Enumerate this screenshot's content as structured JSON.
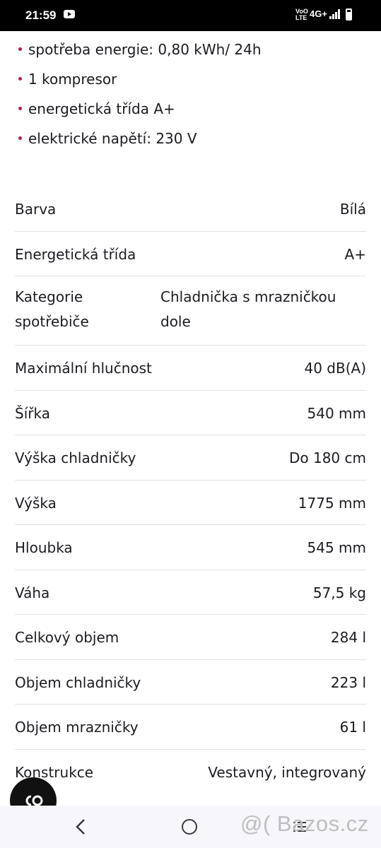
{
  "status_bar": {
    "time": "21:59",
    "net_label_1": "VoO",
    "net_label_2": "LTE",
    "net_type": "4G+"
  },
  "features": [
    "spotřeba energie: 0,80 kWh/ 24h",
    "1 kompresor",
    "energetická třída A+",
    "elektrické napětí: 230 V"
  ],
  "specs": [
    {
      "label": "Barva",
      "value": "Bílá"
    },
    {
      "label": "Energetická třída",
      "value": "A+"
    },
    {
      "label": "Kategorie spotřebiče",
      "value": "Chladnička s mrazničkou dole"
    },
    {
      "label": "Maximální hlučnost",
      "value": "40 dB(A)"
    },
    {
      "label": "Šířka",
      "value": "540 mm"
    },
    {
      "label": "Výška chladničky",
      "value": "Do 180 cm"
    },
    {
      "label": "Výška",
      "value": "1775 mm"
    },
    {
      "label": "Hloubka",
      "value": "545 mm"
    },
    {
      "label": "Váha",
      "value": "57,5 kg"
    },
    {
      "label": "Celkový objem",
      "value": "284 l"
    },
    {
      "label": "Objem chladničky",
      "value": "223 l"
    },
    {
      "label": "Objem mrazničky",
      "value": "61 l"
    },
    {
      "label": "Konstrukce",
      "value": "Vestavný, integrovaný"
    }
  ],
  "watermark": "@( Bazos.cz",
  "colors": {
    "bullet": "#b71c4a",
    "divider": "#e2e2e6",
    "text": "#1c1b21"
  },
  "icons": {
    "fab": "chat-icon",
    "nav_back": "back-icon",
    "nav_home": "home-icon",
    "nav_recents": "recents-icon"
  }
}
